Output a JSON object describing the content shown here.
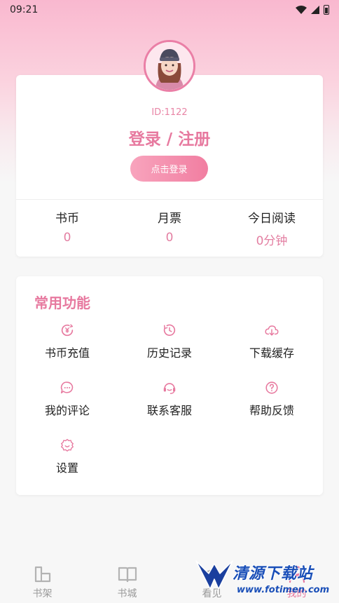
{
  "status_bar": {
    "time": "09:21"
  },
  "profile": {
    "id_text": "ID:1122",
    "login_title": "登录 / 注册",
    "login_button": "点击登录",
    "stats": [
      {
        "label": "书币",
        "value": "0"
      },
      {
        "label": "月票",
        "value": "0"
      },
      {
        "label": "今日阅读",
        "value": "0分钟"
      }
    ]
  },
  "functions": {
    "title": "常用功能",
    "items": [
      {
        "label": "书币充值",
        "icon": "coin-icon"
      },
      {
        "label": "历史记录",
        "icon": "clock-icon"
      },
      {
        "label": "下载缓存",
        "icon": "cloud-download-icon"
      },
      {
        "label": "我的评论",
        "icon": "comment-icon"
      },
      {
        "label": "联系客服",
        "icon": "headset-icon"
      },
      {
        "label": "帮助反馈",
        "icon": "help-icon"
      },
      {
        "label": "设置",
        "icon": "settings-icon"
      }
    ]
  },
  "bottom_nav": [
    {
      "label": "书架",
      "icon": "bookshelf-icon"
    },
    {
      "label": "书城",
      "icon": "book-icon"
    },
    {
      "label": "看见",
      "icon": "eye-icon"
    },
    {
      "label": "我的",
      "icon": "user-icon",
      "active": true
    }
  ],
  "watermark": {
    "text": "清源下载站",
    "url": "www.fotimen.com"
  },
  "colors": {
    "accent": "#e7799f",
    "button_start": "#f8a4bd",
    "button_end": "#f17ea1",
    "nav_inactive": "#9a9a9a"
  }
}
